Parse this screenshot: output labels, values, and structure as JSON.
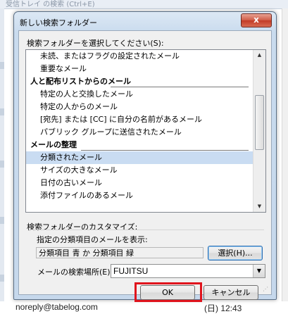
{
  "background": {
    "search_hint": "受信トレイ の検索 (Ctrl+E)",
    "bottom_sender": "noreply@tabelog.com",
    "bottom_date": "(日) 12:43"
  },
  "dialog": {
    "title": "新しい検索フォルダー",
    "close_symbol": "x",
    "select_label": "検索フォルダーを選択してください(S):",
    "list": [
      {
        "type": "item",
        "text": "未読、またはフラグの設定されたメール"
      },
      {
        "type": "item",
        "text": "重要なメール"
      },
      {
        "type": "header",
        "text": "人と配布リストからのメール"
      },
      {
        "type": "item",
        "text": "特定の人と交換したメール"
      },
      {
        "type": "item",
        "text": "特定の人からのメール"
      },
      {
        "type": "item",
        "text": "[宛先] または [CC] に自分の名前があるメール"
      },
      {
        "type": "item",
        "text": "パブリック グループに送信されたメール"
      },
      {
        "type": "header",
        "text": "メールの整理"
      },
      {
        "type": "item",
        "text": "分類されたメール",
        "selected": true
      },
      {
        "type": "item",
        "text": "サイズの大きなメール"
      },
      {
        "type": "item",
        "text": "日付の古いメール"
      },
      {
        "type": "item",
        "text": "添付ファイルのあるメール"
      }
    ],
    "customize_title": "検索フォルダーのカスタマイズ:",
    "criteria_label": "指定の分類項目のメールを表示:",
    "criteria_value": "分類項目 青 か 分類項目 緑",
    "select_button": "選択(H)...",
    "location_label": "メールの検索場所(E):",
    "location_value": "FUJITSU",
    "ok_button": "OK",
    "cancel_button": "キャンセル",
    "highlight_color": "#e0141d"
  }
}
